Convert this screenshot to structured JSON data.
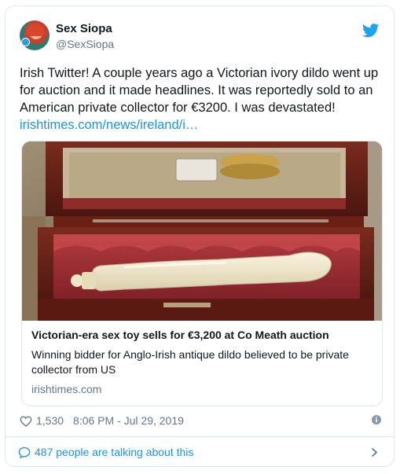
{
  "author": {
    "name": "Sex Siopa",
    "handle": "@SexSiopa"
  },
  "tweet": {
    "text": "Irish Twitter! A couple years ago a Victorian ivory dildo went up for auction and it made headlines. It was reportedly sold to an American private collector for €3200. I was devastated!",
    "link": "irishtimes.com/news/ireland/i…"
  },
  "link_card": {
    "title": "Victorian-era sex toy sells for €3,200 at Co Meath auction",
    "description": "Winning bidder for Anglo-Irish antique dildo believed to be private collector from US",
    "domain": "irishtimes.com"
  },
  "meta": {
    "likes": "1,530",
    "timestamp": "8:06 PM - Jul 29, 2019"
  },
  "footer": {
    "conversation": "487 people are talking about this"
  },
  "colors": {
    "accent": "#1b95e0",
    "muted": "#657786",
    "border": "#e1e8ed"
  },
  "icons": [
    "twitter-bird-icon",
    "heart-icon",
    "info-icon",
    "speech-bubble-icon",
    "chevron-right-icon"
  ]
}
